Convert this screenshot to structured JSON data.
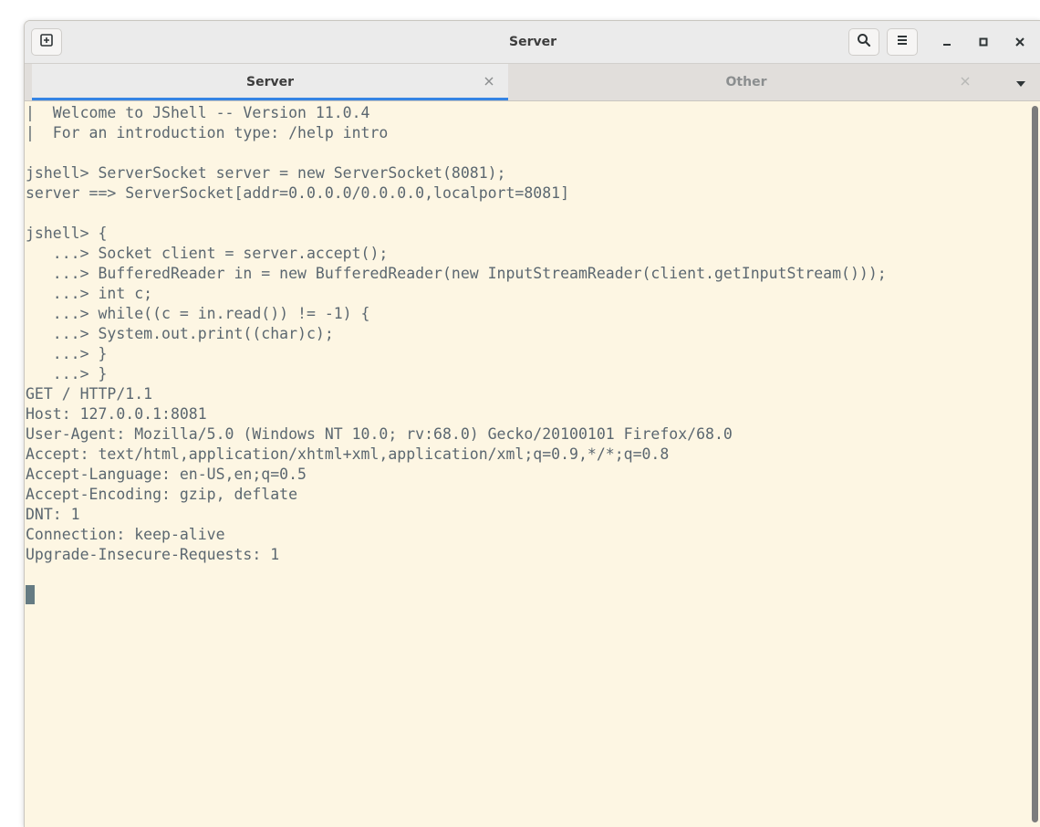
{
  "window": {
    "title": "Server"
  },
  "headerbar": {
    "new_tab_icon": "new-tab-icon",
    "search_icon": "search-icon",
    "menu_icon": "hamburger-menu-icon",
    "minimize_icon": "minimize-icon",
    "maximize_icon": "maximize-icon",
    "close_icon": "close-icon"
  },
  "tabs": [
    {
      "label": "Server",
      "active": true
    },
    {
      "label": "Other",
      "active": false
    }
  ],
  "terminal": {
    "lines": [
      "|  Welcome to JShell -- Version 11.0.4",
      "|  For an introduction type: /help intro",
      "",
      "jshell> ServerSocket server = new ServerSocket(8081);",
      "server ==> ServerSocket[addr=0.0.0.0/0.0.0.0,localport=8081]",
      "",
      "jshell> {",
      "   ...> Socket client = server.accept();",
      "   ...> BufferedReader in = new BufferedReader(new InputStreamReader(client.getInputStream()));",
      "   ...> int c;",
      "   ...> while((c = in.read()) != -1) {",
      "   ...> System.out.print((char)c);",
      "   ...> }",
      "   ...> }",
      "GET / HTTP/1.1",
      "Host: 127.0.0.1:8081",
      "User-Agent: Mozilla/5.0 (Windows NT 10.0; rv:68.0) Gecko/20100101 Firefox/68.0",
      "Accept: text/html,application/xhtml+xml,application/xml;q=0.9,*/*;q=0.8",
      "Accept-Language: en-US,en;q=0.5",
      "Accept-Encoding: gzip, deflate",
      "DNT: 1",
      "Connection: keep-alive",
      "Upgrade-Insecure-Requests: 1"
    ]
  },
  "colors": {
    "terminal_background": "#fdf6e3",
    "terminal_foreground": "#5b6770",
    "active_tab_indicator": "#3584e4",
    "headerbar": "#ebebeb"
  }
}
